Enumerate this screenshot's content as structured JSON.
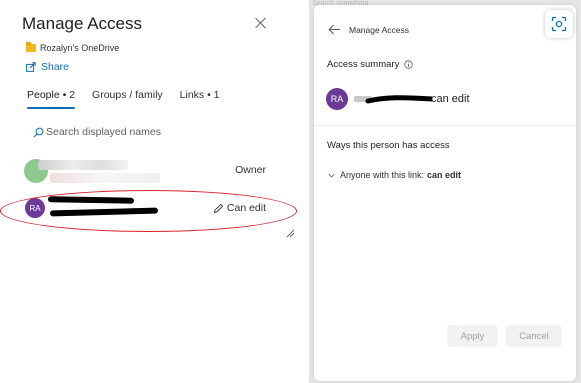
{
  "left_panel": {
    "title": "Manage Access",
    "drive_name": "Rozalyn's OneDrive",
    "share_label": "Share",
    "tabs": [
      {
        "label": "People • 2",
        "active": true
      },
      {
        "label": "Groups / family",
        "active": false
      },
      {
        "label": "Links • 1",
        "active": false
      }
    ],
    "search_placeholder": "Search displayed names",
    "people": [
      {
        "role": "Owner"
      },
      {
        "initials": "RA",
        "role": "Can edit"
      }
    ]
  },
  "right_panel": {
    "top_strip_text": "Search something",
    "title": "Manage Access",
    "access_summary_label": "Access summary",
    "person": {
      "initials": "RA",
      "permission": "can edit"
    },
    "ways_heading": "Ways this person has access",
    "access_item": {
      "text": "Anyone with this link:",
      "permission": "can edit"
    },
    "apply_label": "Apply",
    "cancel_label": "Cancel"
  },
  "colors": {
    "accent": "#0f6cbd",
    "avatar": "#6b3a96",
    "annotation": "#d8232a",
    "folder": "#f2b71b"
  },
  "icons": [
    "close-icon",
    "folder-icon",
    "share-icon",
    "search-icon",
    "pencil-icon",
    "back-icon",
    "scan-icon",
    "info-icon",
    "chevron-down-icon",
    "resize-icon"
  ]
}
